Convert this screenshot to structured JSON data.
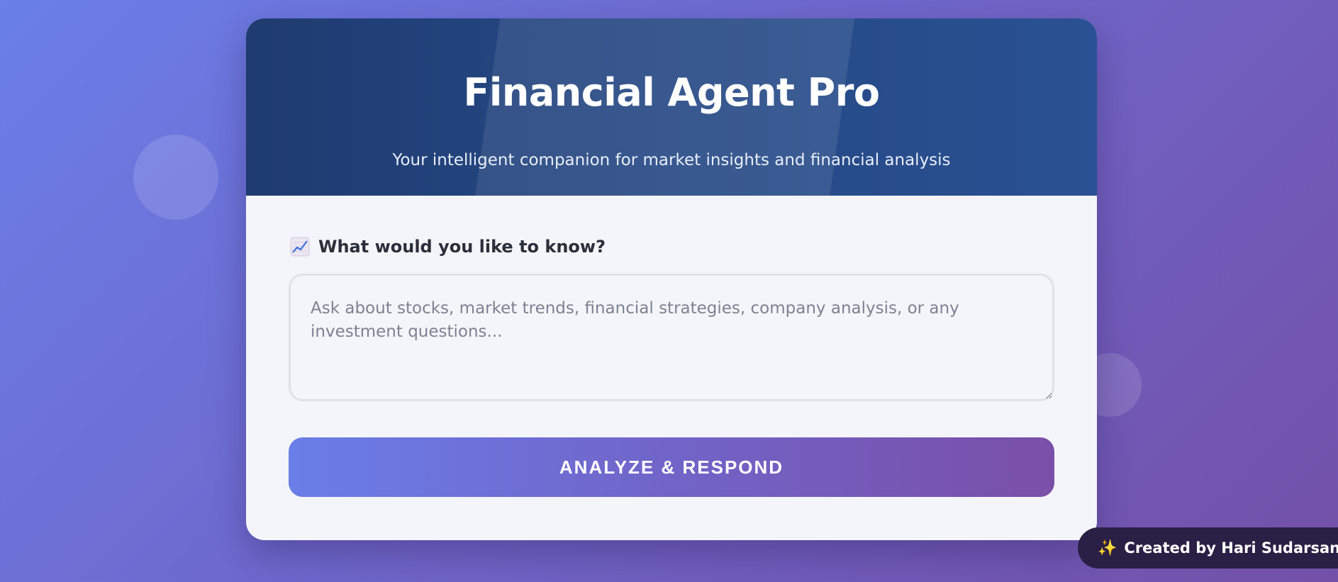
{
  "app": {
    "title": "Financial Agent Pro",
    "subtitle": "Your intelligent companion for market insights and financial analysis"
  },
  "query": {
    "label": "What would you like to know?",
    "label_icon": "chart-increasing-icon",
    "value": "",
    "placeholder": "Ask about stocks, market trends, financial strategies, company analysis, or any investment questions..."
  },
  "actions": {
    "submit_label": "ANALYZE & RESPOND"
  },
  "footer": {
    "credit_icon": "sparkles-icon",
    "credit_text": "Created by Hari Sudarsan"
  },
  "colors": {
    "header_bg": "#23447e",
    "accent_start": "#6a7ee8",
    "accent_end": "#7a4fa8",
    "badge_bg": "#2a1f45"
  }
}
